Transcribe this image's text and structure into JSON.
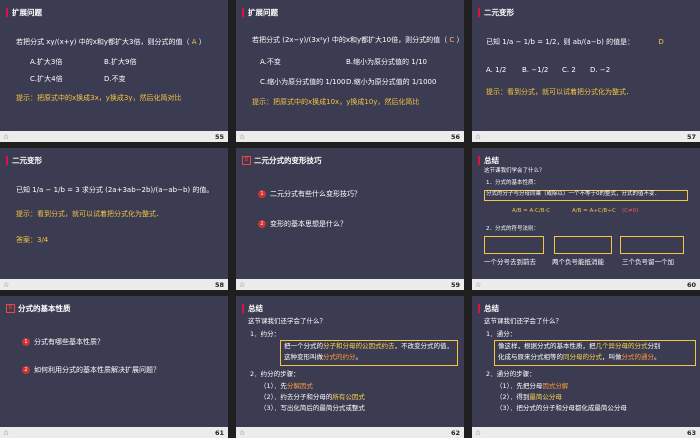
{
  "slides": [
    {
      "num": "55",
      "title": "扩展问题",
      "q": "若把分式 xy/(x+y) 中的x和y都扩大3倍，则分式的值（",
      "ans": "A",
      "close": "）",
      "opts": [
        "A.扩大3倍",
        "B.扩大9倍",
        "C.扩大4倍",
        "D.不变"
      ],
      "hint": "提示：把原式中的x换成3x，y换成3y，然后化简对比"
    },
    {
      "num": "56",
      "title": "扩展问题",
      "q": "若把分式 (2x−y)/(3x²y) 中的x和y都扩大10倍，则分式的值（",
      "ans": "C",
      "close": "）",
      "opts": [
        "A.不变",
        "B.缩小为原分式值的 1/10",
        "C.缩小为原分式值的 1/100",
        "D.缩小为原分式值的 1/1000"
      ],
      "hint": "提示：把原式中的x换成10x，y换成10y，然后化简比"
    },
    {
      "num": "57",
      "title": "二元变形",
      "q": "已知 1/a − 1/b = 1/2，则 ab/(a−b) 的值是：",
      "ans": "D",
      "opts": [
        "A. 1/2",
        "B. −1/2",
        "C. 2",
        "D. −2"
      ],
      "hint": "提示：看到分式，就可以试着把分式化为整式．"
    },
    {
      "num": "58",
      "title": "二元变形",
      "q": "已知 1/a − 1/b = 3 求分式 (2a+3ab−2b)/(a−ab−b) 的值。",
      "hint": "提示：看到分式，就可以试着把分式化为整式．",
      "ans_label": "答案：",
      "ans": "3/4"
    },
    {
      "num": "59",
      "tag": "B",
      "title": "二元分式的变形技巧",
      "items": [
        "二元分式有些什么变形技巧？",
        "变形的基本思想是什么？"
      ]
    },
    {
      "num": "60",
      "title": "总结",
      "sub": "这节课我们学会了什么？",
      "s1": "1．分式的基本性质：",
      "rule": "分式的分子与分母同乘（或除以）一个不等于0的整式，分式的值不变．",
      "f1": "A/B = A·C/B·C",
      "f2": "A/B = A÷C/B÷C",
      "cond": "(C≠0)",
      "s2": "2．分式的符号法则：",
      "r1": "一个分号去到前去",
      "r2": "两个负号能抵消能",
      "r3": "三个负号留一个加"
    },
    {
      "num": "61",
      "tag": "B",
      "title": "分式的基本性质",
      "items": [
        "分式有哪些基本性质？",
        "如何利用分式的基本性质解决扩展问题？"
      ]
    },
    {
      "num": "62",
      "title": "总结",
      "sub": "这节课我们还学会了什么？",
      "l1": "1．约分：",
      "box1a": "把一个分式的",
      "box1b": "分子和分母的公因式约去",
      "box1c": "，不改变分式的值，",
      "box2a": "这种变形叫做",
      "box2b": "分式的约分",
      "box2c": "。",
      "l2": "2．约分的步骤：",
      "st1a": "（1）．先",
      "st1b": "分解因式",
      "st2a": "（2）．约去分子和分母的",
      "st2b": "所有公因式",
      "st3": "（3）．写出化简后的最简分式或整式"
    },
    {
      "num": "63",
      "title": "总结",
      "sub": "这节课我们还学会了什么？",
      "l1": "1．通分：",
      "b1a": "像这样，根据分式的基本性质，把",
      "b1b": "几个异分母的分式",
      "b1c": "分别",
      "b2a": "化成与原来分式相等的",
      "b2b": "同分母的分式",
      "b2c": "，叫做",
      "b2d": "分式的通分",
      "b2e": "。",
      "l2": "2．通分的步骤：",
      "st1a": "（1）．先把分母",
      "st1b": "因式分解",
      "st2a": "（2）．得到",
      "st2b": "最简公分母",
      "st3": "（3）．把分式的分子和分母都化成最简公分母"
    }
  ]
}
